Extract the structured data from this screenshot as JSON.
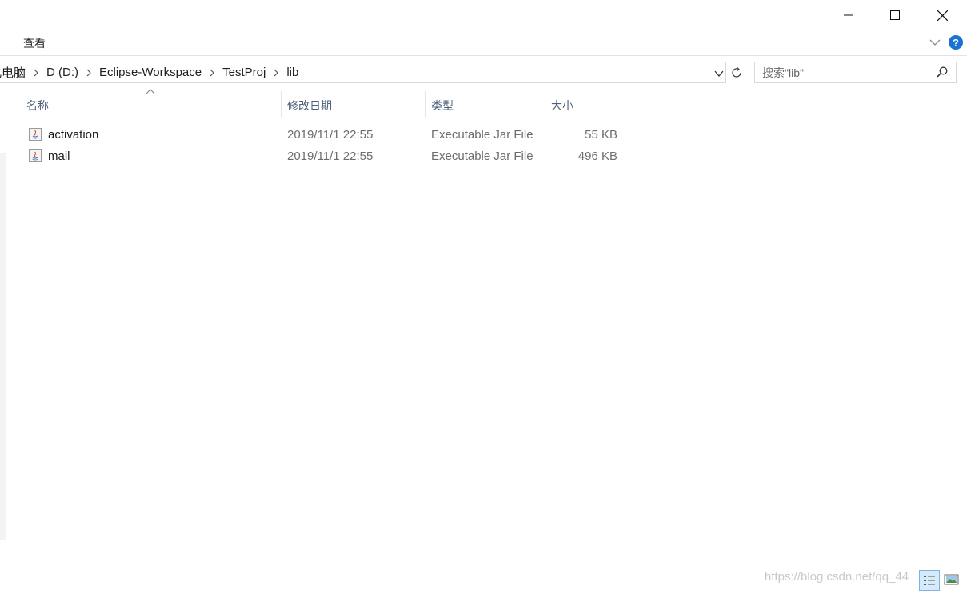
{
  "window": {
    "controls": {
      "minimize_icon": "minimize-icon",
      "maximize_icon": "maximize-icon",
      "close_icon": "close-icon"
    }
  },
  "ribbon": {
    "tab_view": "查看",
    "help_label": "?"
  },
  "address": {
    "breadcrumbs": [
      "此电脑",
      "D (D:)",
      "Eclipse-Workspace",
      "TestProj",
      "lib"
    ]
  },
  "search": {
    "placeholder": "搜索\"lib\""
  },
  "columns": {
    "name": "名称",
    "date": "修改日期",
    "type": "类型",
    "size": "大小"
  },
  "files": [
    {
      "name": "activation",
      "date": "2019/11/1 22:55",
      "type": "Executable Jar File",
      "size": "55 KB",
      "icon": "jar-file-icon"
    },
    {
      "name": "mail",
      "date": "2019/11/1 22:55",
      "type": "Executable Jar File",
      "size": "496 KB",
      "icon": "jar-file-icon"
    }
  ],
  "watermark": "https://blog.csdn.net/qq_44",
  "colors": {
    "header_text": "#4c607a",
    "help_blue": "#1a73d1",
    "selected_view_bg": "#d7eafa"
  }
}
